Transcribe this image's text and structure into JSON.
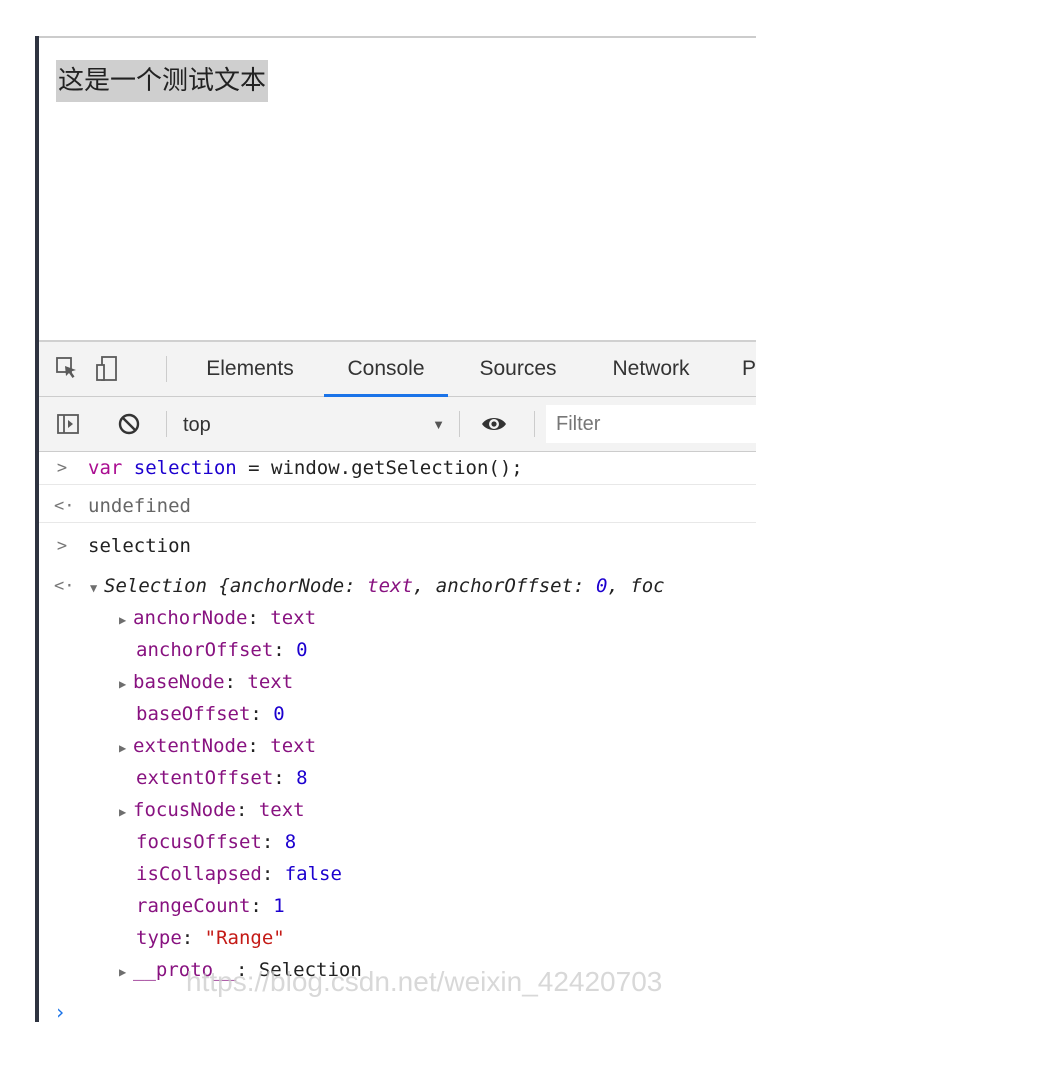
{
  "page": {
    "text": "这是一个测试文本"
  },
  "devtools": {
    "tabs": [
      {
        "label": "Elements"
      },
      {
        "label": "Console",
        "active": true
      },
      {
        "label": "Sources"
      },
      {
        "label": "Network"
      },
      {
        "label": "P"
      }
    ],
    "context": "top",
    "filter_placeholder": "Filter"
  },
  "console": {
    "input1": {
      "keyword": "var",
      "var_name": "selection",
      "rest": " = window.getSelection();"
    },
    "output1": "undefined",
    "input2": "selection",
    "object_summary": {
      "prefix": "Selection {",
      "k1": "anchorNode",
      "v1": "text",
      "k2": "anchorOffset",
      "v2": "0",
      "tail": "foc"
    },
    "props": [
      {
        "key": "anchorNode",
        "value": "text",
        "expandable": true,
        "vtype": "prop-key"
      },
      {
        "key": "anchorOffset",
        "value": "0",
        "expandable": false,
        "vtype": "prop-num"
      },
      {
        "key": "baseNode",
        "value": "text",
        "expandable": true,
        "vtype": "prop-key"
      },
      {
        "key": "baseOffset",
        "value": "0",
        "expandable": false,
        "vtype": "prop-num"
      },
      {
        "key": "extentNode",
        "value": "text",
        "expandable": true,
        "vtype": "prop-key"
      },
      {
        "key": "extentOffset",
        "value": "8",
        "expandable": false,
        "vtype": "prop-num"
      },
      {
        "key": "focusNode",
        "value": "text",
        "expandable": true,
        "vtype": "prop-key"
      },
      {
        "key": "focusOffset",
        "value": "8",
        "expandable": false,
        "vtype": "prop-num"
      },
      {
        "key": "isCollapsed",
        "value": "false",
        "expandable": false,
        "vtype": "prop-num"
      },
      {
        "key": "rangeCount",
        "value": "1",
        "expandable": false,
        "vtype": "prop-num"
      },
      {
        "key": "type",
        "value": "\"Range\"",
        "expandable": false,
        "vtype": "prop-str"
      },
      {
        "key": "__proto__",
        "value": "Selection",
        "expandable": true,
        "vtype": "plain"
      }
    ]
  },
  "watermark": "https://blog.csdn.net/weixin_42420703",
  "colors": {
    "accent": "#1a73e8",
    "frame_border": "#2e3340"
  }
}
